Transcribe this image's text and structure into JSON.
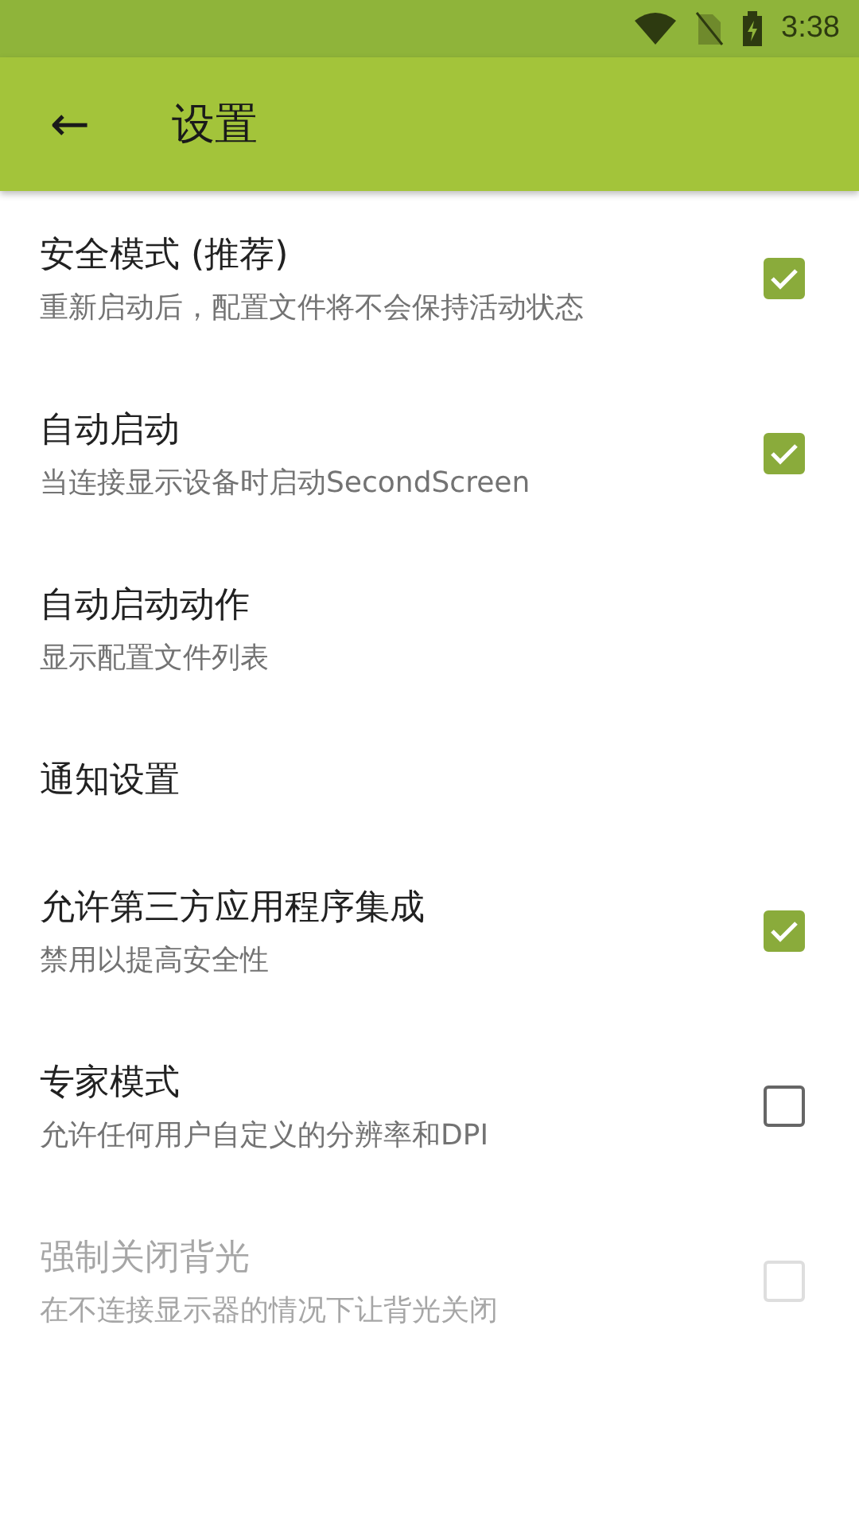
{
  "status_bar": {
    "time": "3:38"
  },
  "app_bar": {
    "back_icon": "←",
    "title": "设置"
  },
  "settings": [
    {
      "kind": "checkbox",
      "title": "安全模式 (推荐)",
      "summary": "重新启动后，配置文件将不会保持活动状态",
      "checked": true,
      "disabled": false
    },
    {
      "kind": "checkbox",
      "title": "自动启动",
      "summary": "当连接显示设备时启动SecondScreen",
      "checked": true,
      "disabled": false
    },
    {
      "kind": "plain",
      "title": "自动启动动作",
      "summary": "显示配置文件列表",
      "disabled": false
    },
    {
      "kind": "plain",
      "title": "通知设置",
      "disabled": false
    },
    {
      "kind": "checkbox",
      "title": "允许第三方应用程序集成",
      "summary": "禁用以提高安全性",
      "checked": true,
      "disabled": false
    },
    {
      "kind": "checkbox",
      "title": "专家模式",
      "summary": "允许任何用户自定义的分辨率和DPI",
      "checked": false,
      "disabled": false
    },
    {
      "kind": "checkbox",
      "title": "强制关闭背光",
      "summary": "在不连接显示器的情况下让背光关闭",
      "checked": false,
      "disabled": true
    }
  ]
}
